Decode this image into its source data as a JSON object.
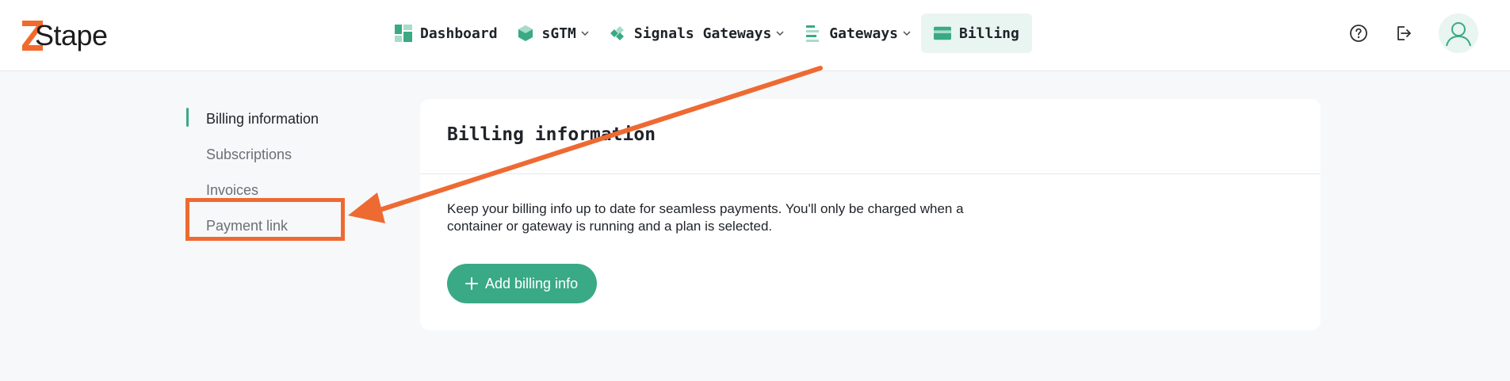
{
  "brand": {
    "name": "Stape",
    "accent": "#3aa986",
    "logo_accent": "#f26a2b"
  },
  "header": {
    "nav": [
      {
        "label": "Dashboard",
        "icon": "dashboard-icon",
        "dropdown": false,
        "active": false
      },
      {
        "label": "sGTM",
        "icon": "cube-icon",
        "dropdown": true,
        "active": false
      },
      {
        "label": "Signals Gateways",
        "icon": "signals-icon",
        "dropdown": true,
        "active": false
      },
      {
        "label": "Gateways",
        "icon": "gateways-icon",
        "dropdown": true,
        "active": false
      },
      {
        "label": "Billing",
        "icon": "credit-card-icon",
        "dropdown": false,
        "active": true
      }
    ],
    "right_icons": [
      "help-icon",
      "logout-icon",
      "user-avatar-icon"
    ]
  },
  "sidebar": {
    "items": [
      {
        "label": "Billing information",
        "active": true
      },
      {
        "label": "Subscriptions",
        "active": false
      },
      {
        "label": "Invoices",
        "active": false
      },
      {
        "label": "Payment link",
        "active": false,
        "highlighted": true
      }
    ]
  },
  "main": {
    "title": "Billing information",
    "description": "Keep your billing info up to date for seamless payments. You'll only be charged when a container or gateway is running and a plan is selected.",
    "add_button_label": "Add billing info"
  },
  "annotation": {
    "color": "#ee6a33",
    "type": "arrow-to-highlight-box"
  }
}
